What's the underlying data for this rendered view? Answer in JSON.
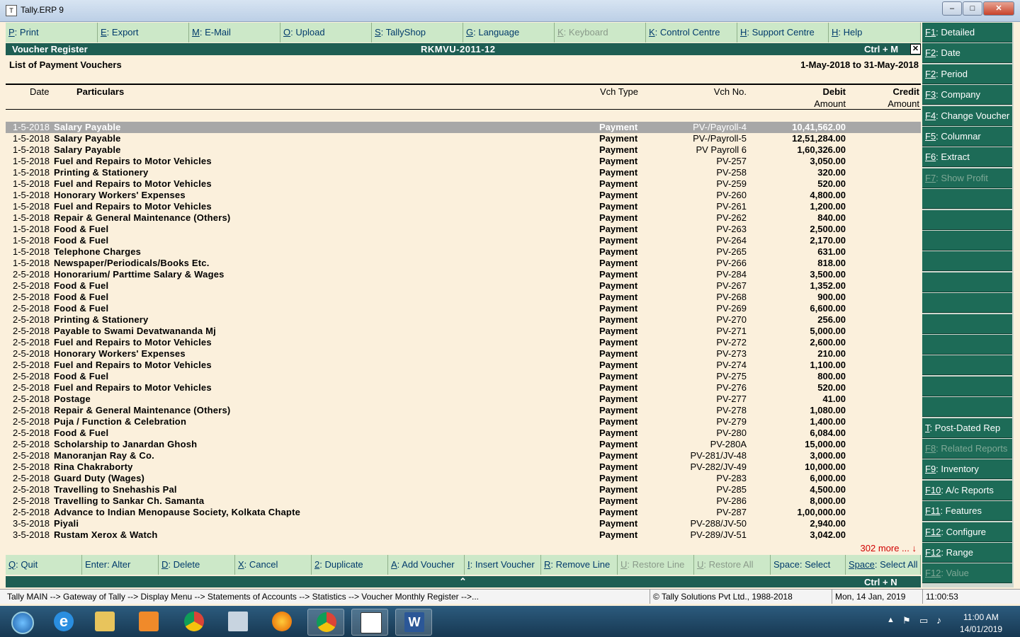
{
  "window": {
    "title": "Tally.ERP 9",
    "app_icon_glyph": "T"
  },
  "top_menu": [
    {
      "key": "P",
      "label": ": Print",
      "enabled": true
    },
    {
      "key": "E",
      "label": ": Export",
      "enabled": true
    },
    {
      "key": "M",
      "label": ": E-Mail",
      "enabled": true
    },
    {
      "key": "O",
      "label": ": Upload",
      "enabled": true
    },
    {
      "key": "S",
      "label": ": TallyShop",
      "enabled": true
    },
    {
      "key": "G",
      "label": ": Language",
      "enabled": true
    },
    {
      "key": "K",
      "label": ": Keyboard",
      "enabled": false
    },
    {
      "key": "K",
      "label": ": Control Centre",
      "enabled": true
    },
    {
      "key": "H",
      "label": ": Support Centre",
      "enabled": true
    },
    {
      "key": "H",
      "label": ": Help",
      "enabled": true
    }
  ],
  "report": {
    "title": "Voucher Register",
    "company": "RKMVU-2011-12",
    "shortcut": "Ctrl + M",
    "close_glyph": "✕",
    "subtitle": "List of Payment Vouchers",
    "period": "1-May-2018 to 31-May-2018",
    "more_text": "302 more ... ↓"
  },
  "columns": {
    "date": "Date",
    "particulars": "Particulars",
    "vch_type": "Vch Type",
    "vch_no": "Vch No.",
    "debit": "Debit",
    "debit_sub": "Amount",
    "credit": "Credit",
    "credit_sub": "Amount"
  },
  "rows": [
    {
      "date": "1-5-2018",
      "particulars": "Salary Payable",
      "type": "Payment",
      "no": "PV-/Payroll-4",
      "debit": "10,41,562.00"
    },
    {
      "date": "1-5-2018",
      "particulars": "Salary Payable",
      "type": "Payment",
      "no": "PV-/Payroll-5",
      "debit": "12,51,284.00"
    },
    {
      "date": "1-5-2018",
      "particulars": "Salary Payable",
      "type": "Payment",
      "no": "PV Payroll  6",
      "debit": "1,60,326.00"
    },
    {
      "date": "1-5-2018",
      "particulars": "Fuel and Repairs to Motor Vehicles",
      "type": "Payment",
      "no": "PV-257",
      "debit": "3,050.00"
    },
    {
      "date": "1-5-2018",
      "particulars": "Printing & Stationery",
      "type": "Payment",
      "no": "PV-258",
      "debit": "320.00"
    },
    {
      "date": "1-5-2018",
      "particulars": "Fuel and Repairs to Motor Vehicles",
      "type": "Payment",
      "no": "PV-259",
      "debit": "520.00"
    },
    {
      "date": "1-5-2018",
      "particulars": "Honorary Workers' Expenses",
      "type": "Payment",
      "no": "PV-260",
      "debit": "4,800.00"
    },
    {
      "date": "1-5-2018",
      "particulars": "Fuel and Repairs to Motor Vehicles",
      "type": "Payment",
      "no": "PV-261",
      "debit": "1,200.00"
    },
    {
      "date": "1-5-2018",
      "particulars": "Repair & General Maintenance (Others)",
      "type": "Payment",
      "no": "PV-262",
      "debit": "840.00"
    },
    {
      "date": "1-5-2018",
      "particulars": "Food & Fuel",
      "type": "Payment",
      "no": "PV-263",
      "debit": "2,500.00"
    },
    {
      "date": "1-5-2018",
      "particulars": "Food & Fuel",
      "type": "Payment",
      "no": "PV-264",
      "debit": "2,170.00"
    },
    {
      "date": "1-5-2018",
      "particulars": "Telephone Charges",
      "type": "Payment",
      "no": "PV-265",
      "debit": "631.00"
    },
    {
      "date": "1-5-2018",
      "particulars": "Newspaper/Periodicals/Books Etc.",
      "type": "Payment",
      "no": "PV-266",
      "debit": "818.00"
    },
    {
      "date": "2-5-2018",
      "particulars": "Honorarium/ Parttime Salary & Wages",
      "type": "Payment",
      "no": "PV-284",
      "debit": "3,500.00"
    },
    {
      "date": "2-5-2018",
      "particulars": "Food & Fuel",
      "type": "Payment",
      "no": "PV-267",
      "debit": "1,352.00"
    },
    {
      "date": "2-5-2018",
      "particulars": "Food & Fuel",
      "type": "Payment",
      "no": "PV-268",
      "debit": "900.00"
    },
    {
      "date": "2-5-2018",
      "particulars": "Food & Fuel",
      "type": "Payment",
      "no": "PV-269",
      "debit": "6,600.00"
    },
    {
      "date": "2-5-2018",
      "particulars": "Printing & Stationery",
      "type": "Payment",
      "no": "PV-270",
      "debit": "256.00"
    },
    {
      "date": "2-5-2018",
      "particulars": "Payable to Swami Devatwananda Mj",
      "type": "Payment",
      "no": "PV-271",
      "debit": "5,000.00"
    },
    {
      "date": "2-5-2018",
      "particulars": "Fuel and Repairs to Motor Vehicles",
      "type": "Payment",
      "no": "PV-272",
      "debit": "2,600.00"
    },
    {
      "date": "2-5-2018",
      "particulars": "Honorary Workers' Expenses",
      "type": "Payment",
      "no": "PV-273",
      "debit": "210.00"
    },
    {
      "date": "2-5-2018",
      "particulars": "Fuel and Repairs to Motor Vehicles",
      "type": "Payment",
      "no": "PV-274",
      "debit": "1,100.00"
    },
    {
      "date": "2-5-2018",
      "particulars": "Food & Fuel",
      "type": "Payment",
      "no": "PV-275",
      "debit": "800.00"
    },
    {
      "date": "2-5-2018",
      "particulars": "Fuel and Repairs to Motor Vehicles",
      "type": "Payment",
      "no": "PV-276",
      "debit": "520.00"
    },
    {
      "date": "2-5-2018",
      "particulars": "Postage",
      "type": "Payment",
      "no": "PV-277",
      "debit": "41.00"
    },
    {
      "date": "2-5-2018",
      "particulars": "Repair & General Maintenance (Others)",
      "type": "Payment",
      "no": "PV-278",
      "debit": "1,080.00"
    },
    {
      "date": "2-5-2018",
      "particulars": "Puja / Function & Celebration",
      "type": "Payment",
      "no": "PV-279",
      "debit": "1,400.00"
    },
    {
      "date": "2-5-2018",
      "particulars": "Food & Fuel",
      "type": "Payment",
      "no": "PV-280",
      "debit": "6,084.00"
    },
    {
      "date": "2-5-2018",
      "particulars": "Scholarship to Janardan Ghosh",
      "type": "Payment",
      "no": "PV-280A",
      "debit": "15,000.00"
    },
    {
      "date": "2-5-2018",
      "particulars": "Manoranjan Ray & Co.",
      "type": "Payment",
      "no": "PV-281/JV-48",
      "debit": "3,000.00"
    },
    {
      "date": "2-5-2018",
      "particulars": "Rina Chakraborty",
      "type": "Payment",
      "no": "PV-282/JV-49",
      "debit": "10,000.00"
    },
    {
      "date": "2-5-2018",
      "particulars": "Guard Duty (Wages)",
      "type": "Payment",
      "no": "PV-283",
      "debit": "6,000.00"
    },
    {
      "date": "2-5-2018",
      "particulars": "Travelling to Snehashis Pal",
      "type": "Payment",
      "no": "PV-285",
      "debit": "4,500.00"
    },
    {
      "date": "2-5-2018",
      "particulars": "Travelling to Sankar Ch. Samanta",
      "type": "Payment",
      "no": "PV-286",
      "debit": "8,000.00"
    },
    {
      "date": "2-5-2018",
      "particulars": "Advance to Indian Menopause Society, Kolkata Chapte",
      "type": "Payment",
      "no": "PV-287",
      "debit": "1,00,000.00"
    },
    {
      "date": "3-5-2018",
      "particulars": "Piyali",
      "type": "Payment",
      "no": "PV-288/JV-50",
      "debit": "2,940.00"
    },
    {
      "date": "3-5-2018",
      "particulars": "Rustam Xerox & Watch",
      "type": "Payment",
      "no": "PV-289/JV-51",
      "debit": "3,042.00"
    }
  ],
  "right_panel": [
    {
      "key": "F1",
      "label": ": Detailed",
      "enabled": true
    },
    {
      "key": "F2",
      "label": ": Date",
      "enabled": true
    },
    {
      "key": "F2",
      "label": ": Period",
      "enabled": true
    },
    {
      "key": "F3",
      "label": ": Company",
      "enabled": true
    },
    {
      "key": "F4",
      "label": ": Change Voucher",
      "enabled": true
    },
    {
      "key": "F5",
      "label": ": Columnar",
      "enabled": true
    },
    {
      "key": "F6",
      "label": ": Extract",
      "enabled": true
    },
    {
      "key": "F7",
      "label": ": Show Profit",
      "enabled": false
    },
    {
      "key": "",
      "label": "",
      "enabled": true
    },
    {
      "key": "",
      "label": "",
      "enabled": true
    },
    {
      "key": "",
      "label": "",
      "enabled": true
    },
    {
      "key": "",
      "label": "",
      "enabled": true
    },
    {
      "key": "",
      "label": "",
      "enabled": true
    },
    {
      "key": "",
      "label": "",
      "enabled": true
    },
    {
      "key": "",
      "label": "",
      "enabled": true
    },
    {
      "key": "",
      "label": "",
      "enabled": true
    },
    {
      "key": "",
      "label": "",
      "enabled": true
    },
    {
      "key": "",
      "label": "",
      "enabled": true
    },
    {
      "key": "",
      "label": "",
      "enabled": true
    },
    {
      "key": "T",
      "label": ": Post-Dated Rep",
      "enabled": true
    },
    {
      "key": "F8",
      "label": ": Related Reports",
      "enabled": false
    },
    {
      "key": "F9",
      "label": ": Inventory Reports",
      "enabled": true
    },
    {
      "key": "F10",
      "label": ": A/c Reports",
      "enabled": true
    },
    {
      "key": "F11",
      "label": ": Features",
      "enabled": true
    },
    {
      "key": "F12",
      "label": ": Configure",
      "enabled": true
    },
    {
      "key": "F12",
      "label": ": Range",
      "enabled": true
    },
    {
      "key": "F12",
      "label": ": Value",
      "enabled": false
    }
  ],
  "bottom_menu": [
    {
      "key": "Q",
      "label": ": Quit",
      "enabled": true
    },
    {
      "key": "Enter",
      "label": ": Alter",
      "enabled": true,
      "plainkey": true
    },
    {
      "key": "D",
      "label": ": Delete",
      "enabled": true
    },
    {
      "key": "X",
      "label": ": Cancel",
      "enabled": true
    },
    {
      "key": "2",
      "label": ": Duplicate",
      "enabled": true
    },
    {
      "key": "A",
      "label": ": Add Voucher",
      "enabled": true
    },
    {
      "key": "I",
      "label": ": Insert Voucher",
      "enabled": true
    },
    {
      "key": "R",
      "label": ": Remove Line",
      "enabled": true
    },
    {
      "key": "U",
      "label": ": Restore Line",
      "enabled": false
    },
    {
      "key": "U",
      "label": ": Restore All",
      "enabled": false
    },
    {
      "key": "Space",
      "label": ": Select",
      "enabled": true,
      "plainkey": true
    },
    {
      "key": "Space",
      "label": ": Select All",
      "enabled": true
    }
  ],
  "bottom_bar": {
    "caret": "⌃",
    "shortcut": "Ctrl + N"
  },
  "status_bar": {
    "breadcrumb": "Tally MAIN --> Gateway of Tally --> Display Menu --> Statements of Accounts --> Statistics --> Voucher Monthly Register -->...",
    "copyright": "© Tally Solutions Pvt Ltd., 1988-2018",
    "date": "Mon, 14 Jan, 2019",
    "time": "11:00:53"
  },
  "taskbar": {
    "icons": [
      "windows-start-icon",
      "internet-explorer-icon",
      "file-explorer-icon",
      "media-player-icon",
      "chrome-icon",
      "calculator-icon",
      "firefox-icon",
      "chrome-icon",
      "tally-icon",
      "word-icon"
    ],
    "clock_time": "11:00 AM",
    "clock_date": "14/01/2019"
  },
  "colors": {
    "header": "#1e5e53",
    "menu": "#cce8c8",
    "panel_button": "#1d6b57",
    "background": "#fbf0dc",
    "more_text": "#d00000"
  }
}
